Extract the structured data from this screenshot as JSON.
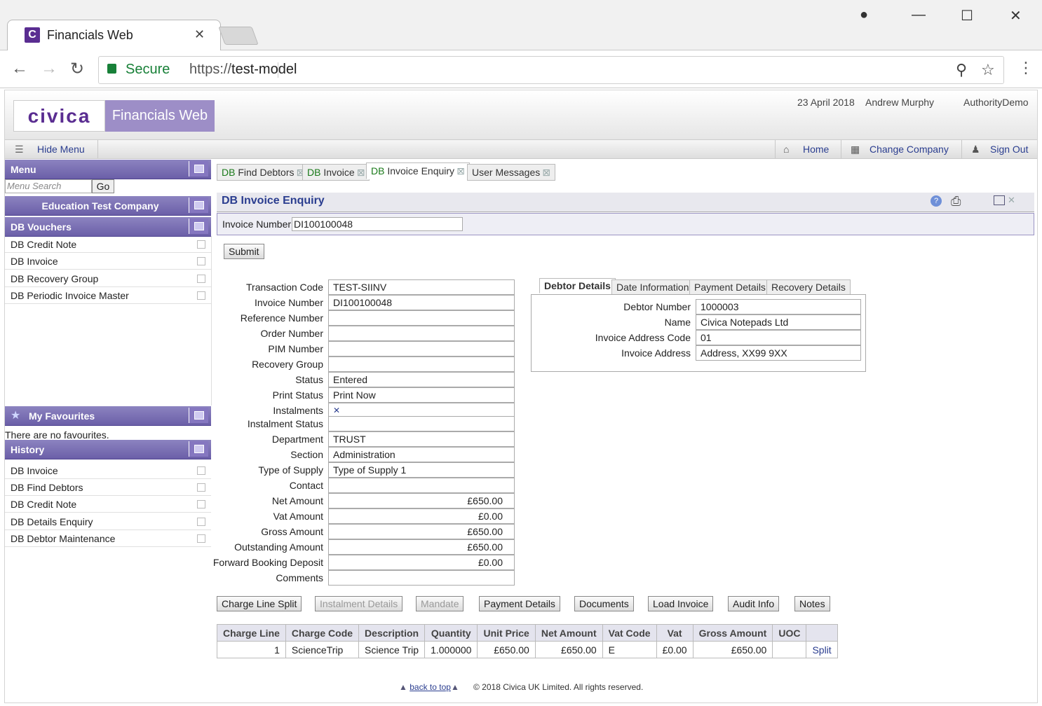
{
  "browser": {
    "tab_title": "Financials Web",
    "tab_favicon": "C",
    "secure_label": "Secure",
    "url_protocol": "https://",
    "url_host": "test-model"
  },
  "header": {
    "logo": "civica",
    "product": "Financials Web",
    "date": "23 April 2018",
    "user": "Andrew Murphy",
    "authority": "AuthorityDemo"
  },
  "topbar": {
    "hide_menu": "Hide Menu",
    "home": "Home",
    "change_company": "Change Company",
    "sign_out": "Sign Out"
  },
  "sidebar": {
    "menu_title": "Menu",
    "search_placeholder": "Menu Search",
    "go": "Go",
    "company": "Education Test Company",
    "section": "DB Vouchers",
    "items": [
      "DB Credit Note",
      "DB Invoice",
      "DB Recovery Group",
      "DB Periodic Invoice Master"
    ],
    "favourites_title": "My Favourites",
    "favourites_empty": "There are no favourites.",
    "history_title": "History",
    "history": [
      "DB Invoice",
      "DB Find Debtors",
      "DB Credit Note",
      "DB Details Enquiry",
      "DB Debtor Maintenance"
    ]
  },
  "tabs": [
    {
      "prefix": "DB",
      "label": "Find Debtors"
    },
    {
      "prefix": "DB",
      "label": "Invoice"
    },
    {
      "prefix": "DB",
      "label": "Invoice Enquiry"
    },
    {
      "prefix": "",
      "label": "User Messages"
    }
  ],
  "panel": {
    "title": "DB Invoice Enquiry",
    "invoice_label": "Invoice Number",
    "invoice_value": "DI100100048",
    "submit": "Submit"
  },
  "form": {
    "fields": [
      {
        "label": "Transaction Code",
        "value": "TEST-SIINV"
      },
      {
        "label": "Invoice Number",
        "value": "DI100100048"
      },
      {
        "label": "Reference Number",
        "value": ""
      },
      {
        "label": "Order Number",
        "value": ""
      },
      {
        "label": "PIM Number",
        "value": ""
      },
      {
        "label": "Recovery Group",
        "value": ""
      },
      {
        "label": "Status",
        "value": "Entered"
      },
      {
        "label": "Print Status",
        "value": "Print Now"
      },
      {
        "label": "Instalments",
        "value": "✕"
      },
      {
        "label": "Instalment Status",
        "value": ""
      },
      {
        "label": "Department",
        "value": "TRUST"
      },
      {
        "label": "Section",
        "value": "Administration"
      },
      {
        "label": "Type of Supply",
        "value": "Type of Supply 1"
      },
      {
        "label": "Contact",
        "value": ""
      },
      {
        "label": "Net Amount",
        "value": "£650.00"
      },
      {
        "label": "Vat Amount",
        "value": "£0.00"
      },
      {
        "label": "Gross Amount",
        "value": "£650.00"
      },
      {
        "label": "Outstanding Amount",
        "value": "£650.00"
      },
      {
        "label": "Forward Booking Deposit",
        "value": "£0.00"
      },
      {
        "label": "Comments",
        "value": ""
      }
    ]
  },
  "detail_tabs": [
    "Debtor Details",
    "Date Information",
    "Payment Details",
    "Recovery Details"
  ],
  "debtor": [
    {
      "label": "Debtor Number",
      "value": "1000003"
    },
    {
      "label": "Name",
      "value": "Civica Notepads Ltd"
    },
    {
      "label": "Invoice Address Code",
      "value": "01"
    },
    {
      "label": "Invoice Address",
      "value": "Address, XX99 9XX"
    }
  ],
  "actions": [
    "Charge Line Split",
    "Instalment Details",
    "Mandate",
    "Payment Details",
    "Documents",
    "Load Invoice",
    "Audit Info",
    "Notes"
  ],
  "grid": {
    "headers": [
      "Charge Line",
      "Charge Code",
      "Description",
      "Quantity",
      "Unit Price",
      "Net Amount",
      "Vat Code",
      "Vat",
      "Gross Amount",
      "UOC",
      ""
    ],
    "rows": [
      [
        "1",
        "ScienceTrip",
        "Science Trip",
        "1.000000",
        "£650.00",
        "£650.00",
        "E",
        "£0.00",
        "£650.00",
        "",
        "Split"
      ]
    ]
  },
  "footer": {
    "back_to_top": "back to top",
    "copyright": "© 2018 Civica UK Limited. All rights reserved."
  }
}
